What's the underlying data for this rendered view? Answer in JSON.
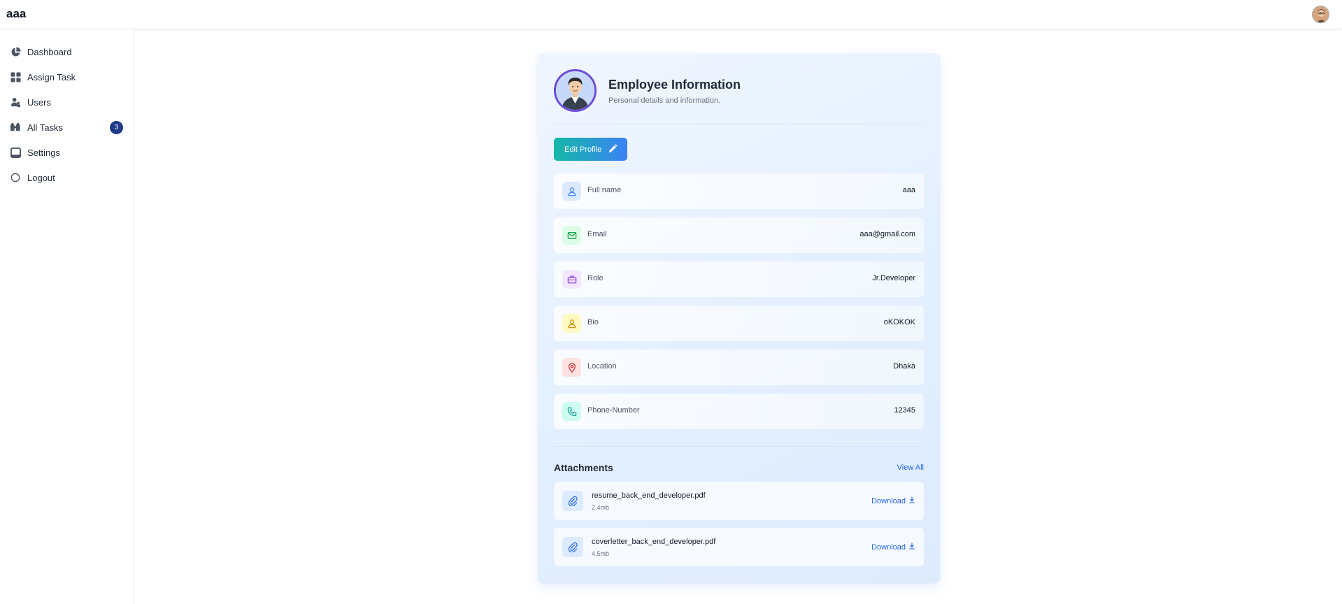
{
  "app": {
    "brand": "aaa"
  },
  "sidebar": {
    "items": [
      {
        "label": "Dashboard",
        "icon": "pie-chart-icon"
      },
      {
        "label": "Assign Task",
        "icon": "grid-icon"
      },
      {
        "label": "Users",
        "icon": "users-icon"
      },
      {
        "label": "All Tasks",
        "icon": "tasks-icon",
        "badge": "3"
      },
      {
        "label": "Settings",
        "icon": "square-icon"
      },
      {
        "label": "Logout",
        "icon": "circle-icon"
      }
    ]
  },
  "profile": {
    "title": "Employee Information",
    "subtitle": "Personal details and information.",
    "edit_label": "Edit Profile",
    "fields": [
      {
        "label": "Full name",
        "value": "aaa",
        "icon": "user-icon",
        "color": "#3b82f6",
        "bg": "#dbeafe"
      },
      {
        "label": "Email",
        "value": "aaa@gmail.com",
        "icon": "mail-icon",
        "color": "#16a34a",
        "bg": "#dcfce7"
      },
      {
        "label": "Role",
        "value": "Jr.Developer",
        "icon": "briefcase-icon",
        "color": "#9333ea",
        "bg": "#f3e8ff"
      },
      {
        "label": "Bio",
        "value": "oKOKOK",
        "icon": "person-icon",
        "color": "#ca8a04",
        "bg": "#fef9c3"
      },
      {
        "label": "Location",
        "value": "Dhaka",
        "icon": "map-pin-icon",
        "color": "#dc2626",
        "bg": "#fee2e2"
      },
      {
        "label": "Phone-Number",
        "value": "12345",
        "icon": "phone-icon",
        "color": "#0d9488",
        "bg": "#ccfbf1"
      }
    ]
  },
  "attachments": {
    "title": "Attachments",
    "view_all": "View All",
    "files": [
      {
        "name": "resume_back_end_developer.pdf",
        "size": "2.4mb",
        "action": "Download"
      },
      {
        "name": "coverletter_back_end_developer.pdf",
        "size": "4.5mb",
        "action": "Download"
      }
    ]
  },
  "colors": {
    "accent": "#2563eb",
    "badge": "#1e3a8a",
    "gradient_start": "#14b8a6",
    "gradient_end": "#3b82f6"
  }
}
